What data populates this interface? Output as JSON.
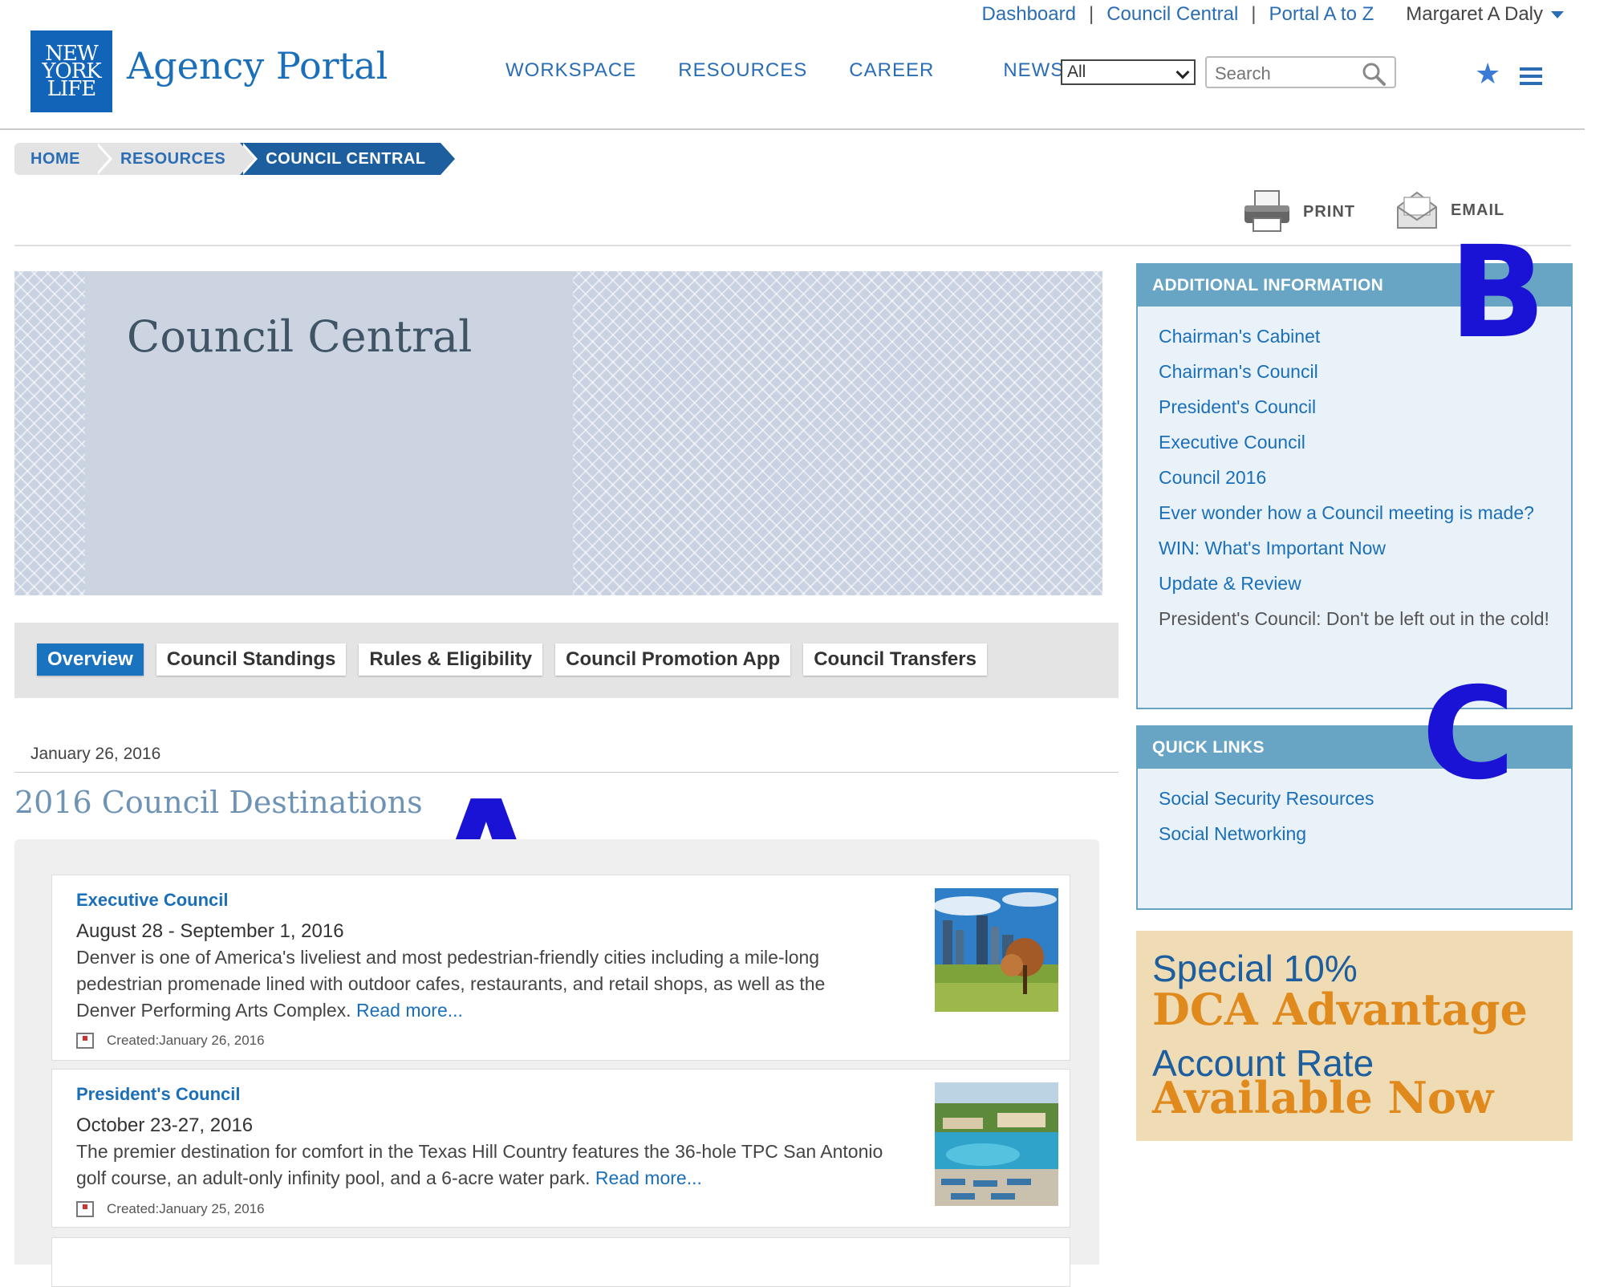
{
  "utility_nav": {
    "links": [
      "Dashboard",
      "Council Central",
      "Portal A to Z"
    ],
    "user": "Margaret A Daly"
  },
  "header": {
    "logo_lines": [
      "NEW",
      "YORK",
      "LIFE"
    ],
    "brand": "Agency Portal",
    "nav": [
      "WORKSPACE",
      "RESOURCES",
      "CAREER",
      "NEWS"
    ],
    "search_scope": "All",
    "search_placeholder": "Search"
  },
  "breadcrumb": [
    "HOME",
    "RESOURCES",
    "COUNCIL CENTRAL"
  ],
  "tools": {
    "print": "PRINT",
    "email": "EMAIL"
  },
  "hero": {
    "title": "Council Central"
  },
  "tabs": [
    "Overview",
    "Council Standings",
    "Rules & Eligibility",
    "Council Promotion App",
    "Council Transfers"
  ],
  "content": {
    "date": "January 26, 2016",
    "section_title": "2016 Council Destinations",
    "articles": [
      {
        "title": "Executive Council",
        "dates": "August 28 - September 1, 2016",
        "desc": "Denver is one of America's liveliest and most pedestrian-friendly cities including a mile-long pedestrian promenade lined with outdoor cafes, restaurants, and retail shops, as well as the Denver Performing Arts Complex.",
        "read_more": "Read more...",
        "created": "Created:January 26, 2016"
      },
      {
        "title": "President's Council",
        "dates": "October 23-27, 2016",
        "desc": "The premier destination for comfort in the Texas Hill Country features the 36-hole TPC San Antonio golf course, an adult-only infinity pool, and a 6-acre water park.",
        "read_more": "Read more...",
        "created": "Created:January 25, 2016"
      }
    ]
  },
  "sidebar": {
    "additional_info": {
      "heading": "ADDITIONAL INFORMATION",
      "links": [
        "Chairman's Cabinet",
        "Chairman's Council",
        "President's Council",
        "Executive Council",
        "Council 2016",
        "Ever wonder how a Council meeting is made?",
        "WIN: What's Important Now",
        "Update & Review",
        "President's Council: Don't be left out in the cold!"
      ]
    },
    "quick_links": {
      "heading": "QUICK LINKS",
      "links": [
        "Social Security Resources",
        "Social Networking"
      ]
    },
    "promo": {
      "line1": "Special 10%",
      "line2": "DCA Advantage",
      "line3": "Account Rate",
      "line4": "Available Now"
    }
  },
  "annotations": {
    "a": "A",
    "b": "B",
    "c": "C"
  }
}
